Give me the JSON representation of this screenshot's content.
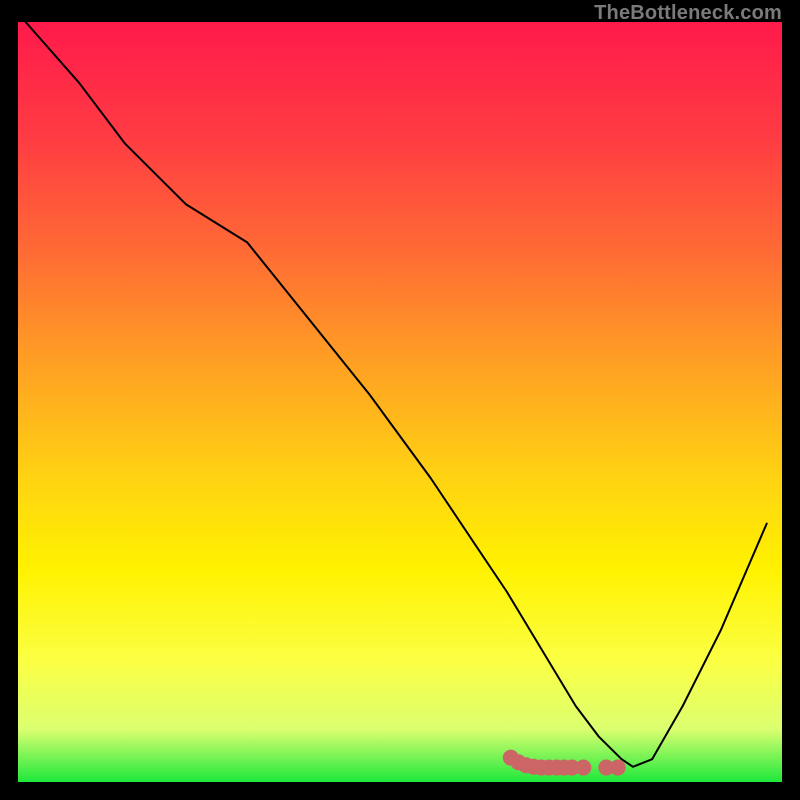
{
  "attribution": "TheBottleneck.com",
  "chart_data": {
    "type": "line",
    "title": "",
    "xlabel": "",
    "ylabel": "",
    "xlim": [
      0,
      100
    ],
    "ylim": [
      0,
      100
    ],
    "grid": false,
    "legend": false,
    "gradient_stops": [
      {
        "pos": 0.0,
        "color": "#ff1a4b"
      },
      {
        "pos": 0.15,
        "color": "#ff3b43"
      },
      {
        "pos": 0.3,
        "color": "#ff6a35"
      },
      {
        "pos": 0.45,
        "color": "#ffa023"
      },
      {
        "pos": 0.6,
        "color": "#ffd312"
      },
      {
        "pos": 0.72,
        "color": "#fff200"
      },
      {
        "pos": 0.84,
        "color": "#fbff43"
      },
      {
        "pos": 0.93,
        "color": "#dcff70"
      },
      {
        "pos": 1.0,
        "color": "#1ee83c"
      }
    ],
    "series": [
      {
        "name": "bottleneck-curve",
        "color": "#000000",
        "width": 2,
        "x": [
          1,
          8,
          14,
          22,
          30,
          38,
          46,
          54,
          60,
          64,
          67,
          70,
          73,
          76,
          79,
          80.5,
          83,
          87,
          92,
          98
        ],
        "y": [
          100,
          92,
          84,
          76,
          71,
          61,
          51,
          40,
          31,
          25,
          20,
          15,
          10,
          6,
          3,
          2,
          3,
          10,
          20,
          34
        ]
      },
      {
        "name": "optimal-marker",
        "type": "scatter",
        "color": "#cc6666",
        "size": 16,
        "x": [
          64.5,
          65.5,
          66.5,
          67.5,
          68.5,
          69.5,
          70.5,
          71.5,
          72.5,
          74.0,
          77.0,
          78.5
        ],
        "y": [
          3.2,
          2.6,
          2.2,
          2.0,
          1.9,
          1.9,
          1.9,
          1.9,
          1.9,
          1.9,
          1.9,
          1.9
        ]
      }
    ]
  }
}
